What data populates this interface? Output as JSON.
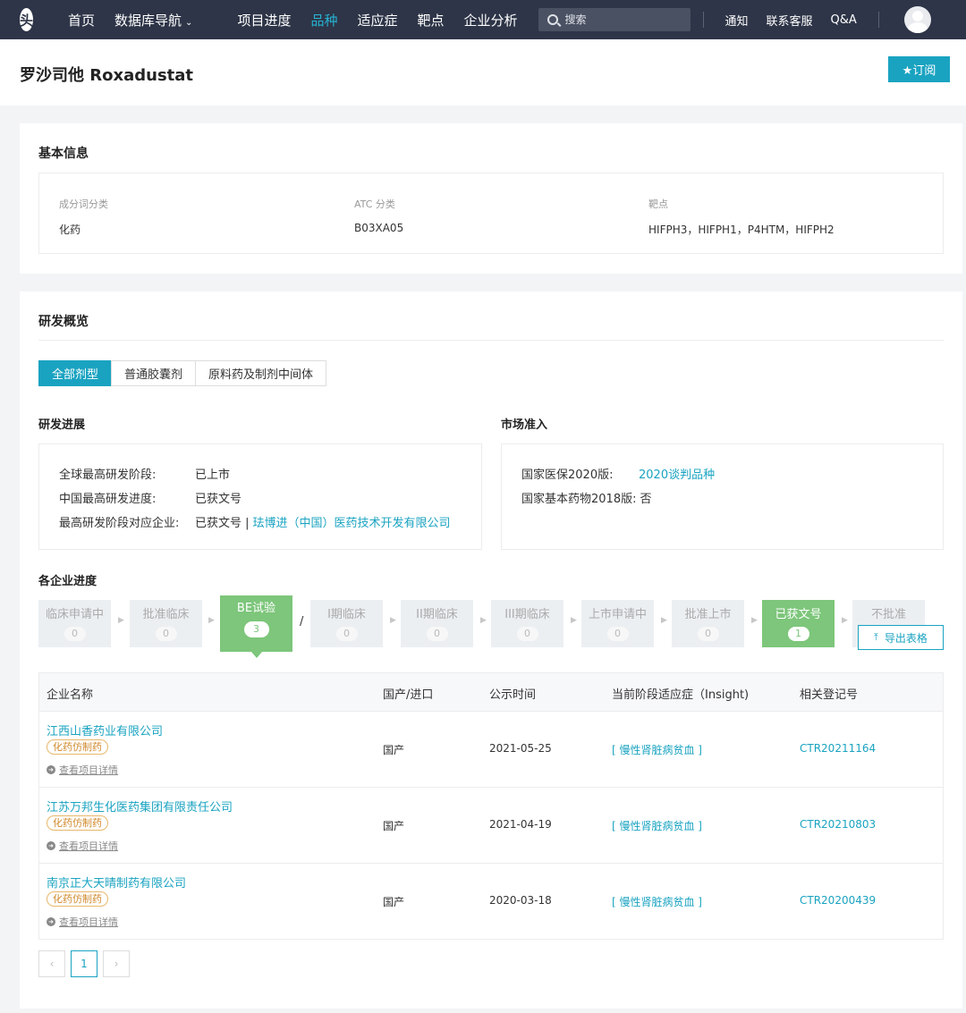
{
  "nav": {
    "logo": "头",
    "items": [
      {
        "label": "首页",
        "active": false
      },
      {
        "label": "数据库导航",
        "active": false,
        "dropdown": true
      }
    ],
    "items2": [
      {
        "label": "项目进度",
        "active": false
      },
      {
        "label": "品种",
        "active": true
      },
      {
        "label": "适应症",
        "active": false
      },
      {
        "label": "靶点",
        "active": false
      },
      {
        "label": "企业分析",
        "active": false
      }
    ],
    "search_placeholder": "搜索",
    "right": [
      "通知",
      "联系客服",
      "Q&A"
    ],
    "caret": "⌄"
  },
  "header": {
    "title": "罗沙司他 Roxadustat",
    "subscribe_label": "★订阅"
  },
  "basic_info": {
    "title": "基本信息",
    "fields": [
      {
        "label": "成分词分类",
        "value": "化药"
      },
      {
        "label": "ATC 分类",
        "value": "B03XA05"
      },
      {
        "label": "靶点",
        "value": "HIFPH3，HIFPH1，P4HTM，HIFPH2"
      }
    ]
  },
  "rd": {
    "title": "研发概览",
    "tabs": [
      {
        "label": "全部剂型",
        "active": true
      },
      {
        "label": "普通胶囊剂",
        "active": false
      },
      {
        "label": "原料药及制剂中间体",
        "active": false
      }
    ],
    "progress": {
      "title": "研发进展",
      "rows": [
        {
          "key": "全球最高研发阶段:",
          "value": "已上市"
        },
        {
          "key": "中国最高研发进度:",
          "value": "已获文号"
        },
        {
          "key": "最高研发阶段对应企业:",
          "value": "已获文号 |",
          "link": "珐博进（中国）医药技术开发有限公司"
        }
      ]
    },
    "market": {
      "title": "市场准入",
      "rows": [
        {
          "key": "国家医保2020版:",
          "value": "",
          "link": "2020谈判品种"
        },
        {
          "key": "国家基本药物2018版:",
          "value": "否"
        }
      ]
    },
    "company_progress": {
      "title": "各企业进度",
      "stages": [
        {
          "name": "临床申请中",
          "count": "0",
          "state": "gray"
        },
        {
          "name": "批准临床",
          "count": "0",
          "state": "gray"
        },
        {
          "name": "BE试验",
          "count": "3",
          "state": "selected"
        },
        {
          "name": "I期临床",
          "count": "0",
          "state": "gray"
        },
        {
          "name": "II期临床",
          "count": "0",
          "state": "gray"
        },
        {
          "name": "III期临床",
          "count": "0",
          "state": "gray"
        },
        {
          "name": "上市申请中",
          "count": "0",
          "state": "gray"
        },
        {
          "name": "批准上市",
          "count": "0",
          "state": "gray"
        },
        {
          "name": "已获文号",
          "count": "1",
          "state": "green"
        },
        {
          "name": "不批准",
          "count": "",
          "state": "gray"
        }
      ],
      "slash": "/",
      "export_label": "导出表格"
    },
    "table": {
      "columns": [
        "企业名称",
        "国产/进口",
        "公示时间",
        "当前阶段适应症（Insight)",
        "相关登记号"
      ],
      "rows": [
        {
          "company": "江西山香药业有限公司",
          "tag": "化药仿制药",
          "detail": "查看项目详情",
          "origin": "国产",
          "date": "2021-05-25",
          "indication": "[ 慢性肾脏病贫血 ]",
          "reg": "CTR20211164"
        },
        {
          "company": "江苏万邦生化医药集团有限责任公司",
          "tag": "化药仿制药",
          "detail": "查看项目详情",
          "origin": "国产",
          "date": "2021-04-19",
          "indication": "[ 慢性肾脏病贫血 ]",
          "reg": "CTR20210803"
        },
        {
          "company": "南京正大天晴制药有限公司",
          "tag": "化药仿制药",
          "detail": "查看项目详情",
          "origin": "国产",
          "date": "2020-03-18",
          "indication": "[ 慢性肾脏病贫血 ]",
          "reg": "CTR20200439"
        }
      ]
    },
    "pager": {
      "prev": "‹",
      "current": "1",
      "next": "›"
    }
  },
  "colors": {
    "accent": "#1aa3c1",
    "nav_bg": "#2e3548",
    "stage_green": "#7dc67b",
    "tag_orange": "#d18a2c"
  }
}
